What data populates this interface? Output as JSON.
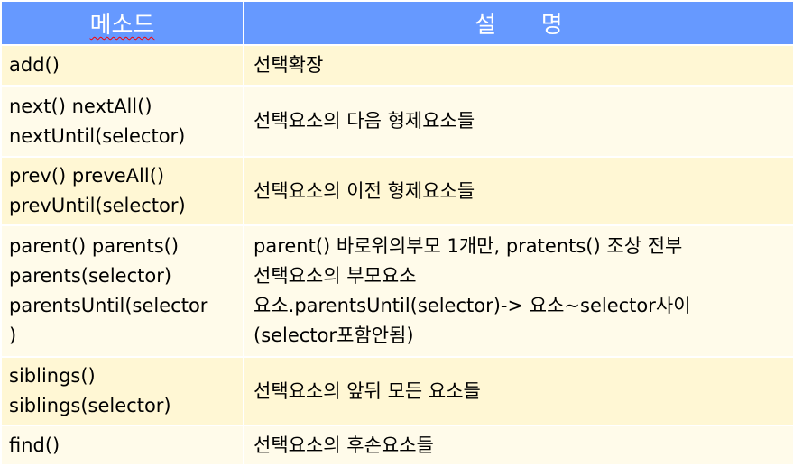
{
  "header": {
    "method": "메소드",
    "description": "설      명"
  },
  "rows": [
    {
      "method": [
        "add()"
      ],
      "description": [
        "선택확장"
      ]
    },
    {
      "method": [
        "next() nextAll()",
        "nextUntil(selector)"
      ],
      "description": [
        "선택요소의 다음 형제요소들"
      ]
    },
    {
      "method": [
        "prev() preveAll()",
        "prevUntil(selector)"
      ],
      "description": [
        "선택요소의 이전 형제요소들"
      ]
    },
    {
      "method": [
        "parent() parents()",
        "parents(selector)",
        "parentsUntil(selector",
        ")"
      ],
      "description": [
        "parent() 바로위의부모 1개만, pratents() 조상 전부",
        "선택요소의 부모요소",
        "요소.parentsUntil(selector)-> 요소~selector사이",
        "(selector포함안됨)"
      ]
    },
    {
      "method": [
        "siblings()",
        "siblings(selector)"
      ],
      "description": [
        "선택요소의 앞뒤 모든 요소들"
      ]
    },
    {
      "method": [
        "find()"
      ],
      "description": [
        "선택요소의 후손요소들"
      ]
    }
  ],
  "colors": {
    "header": "#6699ff",
    "row_dark": "#fff7d4",
    "row_light": "#fffbea"
  }
}
